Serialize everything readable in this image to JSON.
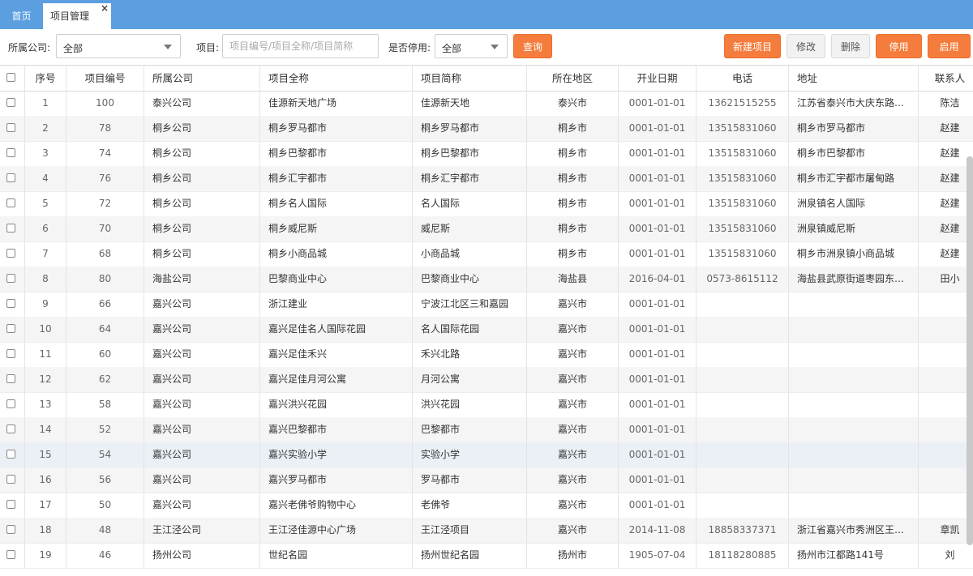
{
  "tabs": [
    {
      "label": "首页"
    },
    {
      "label": "项目管理",
      "close": "×"
    }
  ],
  "toolbar": {
    "company_label": "所属公司:",
    "company_value": "全部",
    "project_label": "项目:",
    "project_placeholder": "项目编号/项目全称/项目简称",
    "disabled_label": "是否停用:",
    "disabled_value": "全部",
    "search_button": "查询",
    "new_button": "新建项目",
    "edit_button": "修改",
    "delete_button": "删除",
    "disable_button": "停用",
    "enable_button": "启用"
  },
  "colors": {
    "accent": "#f47c3c",
    "tabbar": "#5b9fe0"
  },
  "table": {
    "headers": [
      "序号",
      "项目编号",
      "所属公司",
      "项目全称",
      "项目简称",
      "所在地区",
      "开业日期",
      "电话",
      "地址",
      "联系人"
    ],
    "rows": [
      [
        "1",
        "100",
        "泰兴公司",
        "佳源新天地广场",
        "佳源新天地",
        "泰兴市",
        "0001-01-01",
        "13621515255",
        "江苏省泰兴市大庆东路9...",
        "陈洁"
      ],
      [
        "2",
        "78",
        "桐乡公司",
        "桐乡罗马都市",
        "桐乡罗马都市",
        "桐乡市",
        "0001-01-01",
        "13515831060",
        "桐乡市罗马都市",
        "赵建"
      ],
      [
        "3",
        "74",
        "桐乡公司",
        "桐乡巴黎都市",
        "桐乡巴黎都市",
        "桐乡市",
        "0001-01-01",
        "13515831060",
        "桐乡市巴黎都市",
        "赵建"
      ],
      [
        "4",
        "76",
        "桐乡公司",
        "桐乡汇宇都市",
        "桐乡汇宇都市",
        "桐乡市",
        "0001-01-01",
        "13515831060",
        "桐乡市汇宇都市屠甸路",
        "赵建"
      ],
      [
        "5",
        "72",
        "桐乡公司",
        "桐乡名人国际",
        "名人国际",
        "桐乡市",
        "0001-01-01",
        "13515831060",
        "洲泉镇名人国际",
        "赵建"
      ],
      [
        "6",
        "70",
        "桐乡公司",
        "桐乡威尼斯",
        "威尼斯",
        "桐乡市",
        "0001-01-01",
        "13515831060",
        "洲泉镇威尼斯",
        "赵建"
      ],
      [
        "7",
        "68",
        "桐乡公司",
        "桐乡小商品城",
        "小商品城",
        "桐乡市",
        "0001-01-01",
        "13515831060",
        "桐乡市洲泉镇小商品城",
        "赵建"
      ],
      [
        "8",
        "80",
        "海盐公司",
        "巴黎商业中心",
        "巴黎商业中心",
        "海盐县",
        "2016-04-01",
        "0573-8615112",
        "海盐县武原街道枣园东路...",
        "田小"
      ],
      [
        "9",
        "66",
        "嘉兴公司",
        "浙江建业",
        "宁波江北区三和嘉园",
        "嘉兴市",
        "0001-01-01",
        "",
        "",
        ""
      ],
      [
        "10",
        "64",
        "嘉兴公司",
        "嘉兴足佳名人国际花园",
        "名人国际花园",
        "嘉兴市",
        "0001-01-01",
        "",
        "",
        ""
      ],
      [
        "11",
        "60",
        "嘉兴公司",
        "嘉兴足佳禾兴",
        "禾兴北路",
        "嘉兴市",
        "0001-01-01",
        "",
        "",
        ""
      ],
      [
        "12",
        "62",
        "嘉兴公司",
        "嘉兴足佳月河公寓",
        "月河公寓",
        "嘉兴市",
        "0001-01-01",
        "",
        "",
        ""
      ],
      [
        "13",
        "58",
        "嘉兴公司",
        "嘉兴洪兴花园",
        "洪兴花园",
        "嘉兴市",
        "0001-01-01",
        "",
        "",
        ""
      ],
      [
        "14",
        "52",
        "嘉兴公司",
        "嘉兴巴黎都市",
        "巴黎都市",
        "嘉兴市",
        "0001-01-01",
        "",
        "",
        ""
      ],
      [
        "15",
        "54",
        "嘉兴公司",
        "嘉兴实验小学",
        "实验小学",
        "嘉兴市",
        "0001-01-01",
        "",
        "",
        ""
      ],
      [
        "16",
        "56",
        "嘉兴公司",
        "嘉兴罗马都市",
        "罗马都市",
        "嘉兴市",
        "0001-01-01",
        "",
        "",
        ""
      ],
      [
        "17",
        "50",
        "嘉兴公司",
        "嘉兴老佛爷购物中心",
        "老佛爷",
        "嘉兴市",
        "0001-01-01",
        "",
        "",
        ""
      ],
      [
        "18",
        "48",
        "王江泾公司",
        "王江泾佳源中心广场",
        "王江泾项目",
        "嘉兴市",
        "2014-11-08",
        "18858337371",
        "浙江省嘉兴市秀洲区王江...",
        "章凯"
      ],
      [
        "19",
        "46",
        "扬州公司",
        "世纪名园",
        "扬州世纪名园",
        "扬州市",
        "1905-07-04",
        "18118280885",
        "扬州市江都路141号",
        "刘"
      ]
    ]
  }
}
